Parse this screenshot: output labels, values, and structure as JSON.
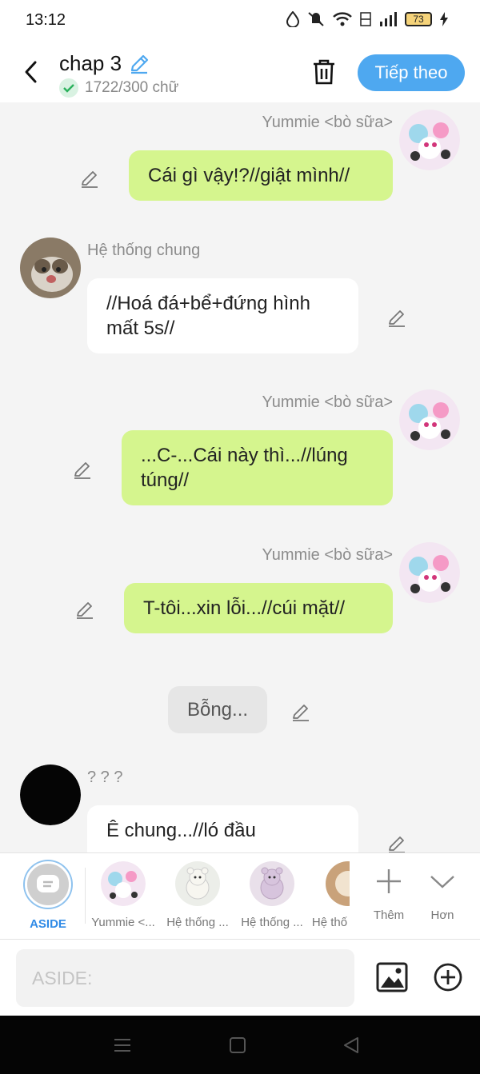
{
  "status": {
    "time": "13:12",
    "battery": "73"
  },
  "header": {
    "title": "chap 3",
    "word_count": "1722/300 chữ",
    "next_label": "Tiếp theo"
  },
  "messages": [
    {
      "sender": "Yummie <bò sữa>",
      "text": "Cái gì vậy!?//giật mình//"
    },
    {
      "sender": "Hệ thống chung",
      "text": "//Hoá đá+bể+đứng hình mất 5s//"
    },
    {
      "sender": "Yummie <bò sữa>",
      "text": "...C-...Cái này thì...//lúng túng//"
    },
    {
      "sender": "Yummie <bò sữa>",
      "text": "T-tôi...xin lỗi...//cúi mặt//"
    },
    {
      "text": "Bỗng..."
    },
    {
      "sender": "? ? ?",
      "text": "Ê chung...//ló đầu"
    }
  ],
  "characters": [
    {
      "label": "ASIDE"
    },
    {
      "label": "Yummie <..."
    },
    {
      "label": "Hệ thống ..."
    },
    {
      "label": "Hệ thống ..."
    },
    {
      "label": "Hệ thố"
    }
  ],
  "more_label": "Thêm",
  "collapse_label": "Hơn",
  "input": {
    "placeholder": "ASIDE:"
  },
  "colors": {
    "accent": "#4ea8f0",
    "own_bubble": "#d5f58e",
    "other_bubble": "#ffffff"
  }
}
